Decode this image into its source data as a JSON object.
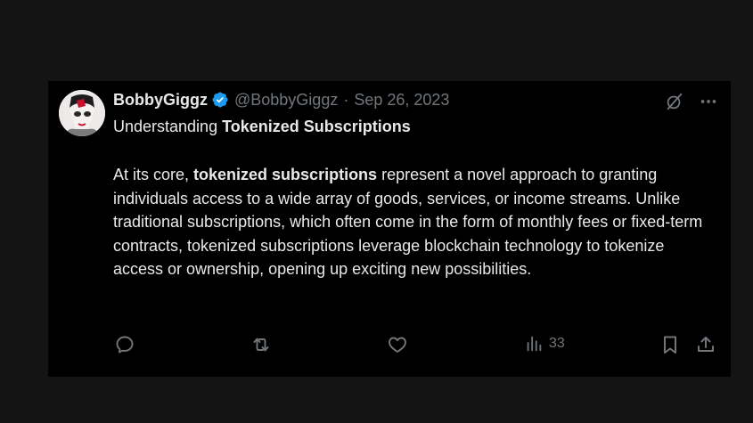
{
  "tweet": {
    "author": {
      "display_name": "BobbyGiggz",
      "handle": "@BobbyGiggz",
      "verified": true,
      "avatar_icon": "avatar-portrait"
    },
    "separator": "·",
    "date": "Sep 26, 2023",
    "title": {
      "prefix": "Understanding ",
      "bold": "Tokenized Subscriptions"
    },
    "body": {
      "intro": "At its core, ",
      "bold": "tokenized subscriptions",
      "rest": " represent a novel approach to granting individuals access to a wide array of goods, services, or income streams. Unlike traditional subscriptions, which often come in the form of monthly fees or fixed-term contracts, tokenized subscriptions leverage blockchain technology to tokenize access or ownership, opening up exciting new possibilities."
    },
    "actions": {
      "reply_icon": "reply-icon",
      "retweet_icon": "retweet-icon",
      "like_icon": "heart-icon",
      "views_icon": "views-icon",
      "views_count": "33",
      "bookmark_icon": "bookmark-icon",
      "share_icon": "share-icon"
    },
    "top_actions": {
      "grok_icon": "grok-icon",
      "more_icon": "more-icon"
    },
    "colors": {
      "background": "#141414",
      "card": "#000000",
      "text": "#e7e9ea",
      "muted": "#71767b",
      "verified": "#1d9bf0"
    }
  }
}
